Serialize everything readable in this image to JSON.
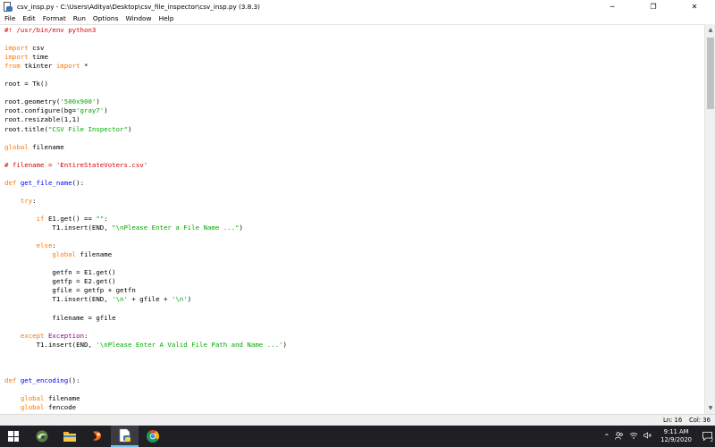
{
  "window": {
    "title": "csv_insp.py - C:\\Users\\Aditya\\Desktop\\csv_file_inspector\\csv_insp.py (3.8.3)",
    "app_icon": "idle-python-file-icon",
    "controls": {
      "minimize": "─",
      "maximize": "❐",
      "close": "✕"
    }
  },
  "menubar": {
    "items": [
      "File",
      "Edit",
      "Format",
      "Run",
      "Options",
      "Window",
      "Help"
    ]
  },
  "editor": {
    "lines": [
      [
        {
          "t": "#! /usr/bin/env python3",
          "c": "cmt"
        }
      ],
      [],
      [
        {
          "t": "import",
          "c": "kw"
        },
        {
          "t": " csv",
          "c": ""
        }
      ],
      [
        {
          "t": "import",
          "c": "kw"
        },
        {
          "t": " time",
          "c": ""
        }
      ],
      [
        {
          "t": "from",
          "c": "kw"
        },
        {
          "t": " tkinter ",
          "c": ""
        },
        {
          "t": "import",
          "c": "kw"
        },
        {
          "t": " *",
          "c": ""
        }
      ],
      [],
      [
        {
          "t": "root = Tk()",
          "c": ""
        }
      ],
      [],
      [
        {
          "t": "root.geometry(",
          "c": ""
        },
        {
          "t": "'500x900'",
          "c": "str"
        },
        {
          "t": ")",
          "c": ""
        }
      ],
      [
        {
          "t": "root.configure(bg=",
          "c": ""
        },
        {
          "t": "'gray7'",
          "c": "str"
        },
        {
          "t": ")",
          "c": ""
        }
      ],
      [
        {
          "t": "root.resizable(1,1)",
          "c": ""
        }
      ],
      [
        {
          "t": "root.title(",
          "c": ""
        },
        {
          "t": "\"CSV File Inspector\"",
          "c": "str"
        },
        {
          "t": ")",
          "c": ""
        }
      ],
      [],
      [
        {
          "t": "global",
          "c": "kw"
        },
        {
          "t": " filename",
          "c": ""
        }
      ],
      [],
      [
        {
          "t": "# filename = 'EntireStateVoters.csv'",
          "c": "cmt"
        }
      ],
      [],
      [
        {
          "t": "def",
          "c": "kw"
        },
        {
          "t": " ",
          "c": ""
        },
        {
          "t": "get_file_name",
          "c": "def"
        },
        {
          "t": "():",
          "c": ""
        }
      ],
      [],
      [
        {
          "t": "    ",
          "c": ""
        },
        {
          "t": "try",
          "c": "kw"
        },
        {
          "t": ":",
          "c": ""
        }
      ],
      [],
      [
        {
          "t": "        ",
          "c": ""
        },
        {
          "t": "if",
          "c": "kw"
        },
        {
          "t": " E1.get() == ",
          "c": ""
        },
        {
          "t": "\"\"",
          "c": "str"
        },
        {
          "t": ":",
          "c": ""
        }
      ],
      [
        {
          "t": "            T1.insert(END, ",
          "c": ""
        },
        {
          "t": "\"\\nPlease Enter a File Name ...\"",
          "c": "str"
        },
        {
          "t": ")",
          "c": ""
        }
      ],
      [],
      [
        {
          "t": "        ",
          "c": ""
        },
        {
          "t": "else",
          "c": "kw"
        },
        {
          "t": ":",
          "c": ""
        }
      ],
      [
        {
          "t": "            ",
          "c": ""
        },
        {
          "t": "global",
          "c": "kw"
        },
        {
          "t": " filename",
          "c": ""
        }
      ],
      [],
      [
        {
          "t": "            getfn = E1.get()",
          "c": ""
        }
      ],
      [
        {
          "t": "            getfp = E2.get()",
          "c": ""
        }
      ],
      [
        {
          "t": "            gfile = getfp + getfn",
          "c": ""
        }
      ],
      [
        {
          "t": "            T1.insert(END, ",
          "c": ""
        },
        {
          "t": "'\\n'",
          "c": "str"
        },
        {
          "t": " + gfile + ",
          "c": ""
        },
        {
          "t": "'\\n'",
          "c": "str"
        },
        {
          "t": ")",
          "c": ""
        }
      ],
      [],
      [
        {
          "t": "            filename = gfile",
          "c": ""
        }
      ],
      [],
      [
        {
          "t": "    ",
          "c": ""
        },
        {
          "t": "except",
          "c": "kw"
        },
        {
          "t": " ",
          "c": ""
        },
        {
          "t": "Exception",
          "c": "bi"
        },
        {
          "t": ":",
          "c": ""
        }
      ],
      [
        {
          "t": "        T1.insert(END, ",
          "c": ""
        },
        {
          "t": "'\\nPlease Enter A Valid File Path and Name ...'",
          "c": "str"
        },
        {
          "t": ")",
          "c": ""
        }
      ],
      [],
      [],
      [],
      [
        {
          "t": "def",
          "c": "kw"
        },
        {
          "t": " ",
          "c": ""
        },
        {
          "t": "get_encoding",
          "c": "def"
        },
        {
          "t": "():",
          "c": ""
        }
      ],
      [],
      [
        {
          "t": "    ",
          "c": ""
        },
        {
          "t": "global",
          "c": "kw"
        },
        {
          "t": " filename",
          "c": ""
        }
      ],
      [
        {
          "t": "    ",
          "c": ""
        },
        {
          "t": "global",
          "c": "kw"
        },
        {
          "t": " fencode",
          "c": ""
        }
      ]
    ]
  },
  "statusbar": {
    "line": "Ln: 16",
    "col": "Col: 36"
  },
  "taskbar": {
    "apps": [
      {
        "name": "start-button",
        "icon": "windows-logo-icon"
      },
      {
        "name": "taskbar-app-1",
        "icon": "browser-swirl-icon"
      },
      {
        "name": "taskbar-app-file-explorer",
        "icon": "folder-icon"
      },
      {
        "name": "taskbar-app-3",
        "icon": "orange-app-icon"
      },
      {
        "name": "taskbar-app-python-idle",
        "icon": "python-idle-icon",
        "active": true
      },
      {
        "name": "taskbar-app-chrome",
        "icon": "chrome-icon"
      }
    ],
    "clock_time": "9:11 AM",
    "clock_date": "12/9/2020",
    "notification_count": "2"
  }
}
